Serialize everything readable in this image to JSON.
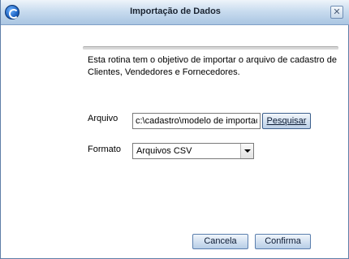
{
  "window": {
    "title": "Importação de Dados",
    "close_label": "✕"
  },
  "description": "Esta rotina tem o objetivo de importar o arquivo de cadastro de Clientes, Vendedores e Fornecedores.",
  "form": {
    "arquivo_label": "Arquivo",
    "arquivo_value": "c:\\cadastro\\modelo de importacao.csv",
    "pesquisar_label": "Pesquisar",
    "formato_label": "Formato",
    "formato_selected": "Arquivos CSV"
  },
  "footer": {
    "cancel_label": "Cancela",
    "confirm_label": "Confirma"
  },
  "icons": {
    "app": "app-logo-icon",
    "close": "close-icon",
    "dropdown": "chevron-down-icon"
  }
}
